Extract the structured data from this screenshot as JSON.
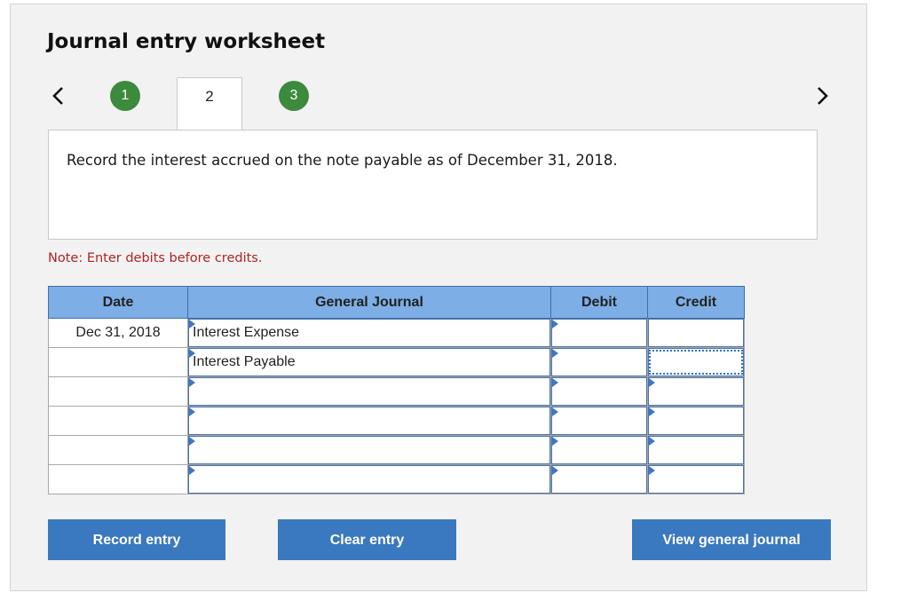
{
  "worksheet": {
    "title": "Journal entry worksheet",
    "steps": [
      "1",
      "2",
      "3"
    ],
    "active_step": "2",
    "prompt": "Record the interest accrued on the note payable as of December 31, 2018.",
    "note": "Note: Enter debits before credits."
  },
  "icons": {
    "prev": "chevron-left-icon",
    "next": "chevron-right-icon"
  },
  "colors": {
    "step_complete": "#3c8a3c",
    "header": "#7daee5",
    "button": "#3a78bf",
    "note": "#b22222"
  },
  "table": {
    "headers": [
      "Date",
      "General Journal",
      "Debit",
      "Credit"
    ],
    "rows": [
      {
        "date": "Dec 31, 2018",
        "account": "Interest Expense",
        "debit": "",
        "credit": ""
      },
      {
        "date": "",
        "account": "Interest Payable",
        "debit": "",
        "credit": ""
      },
      {
        "date": "",
        "account": "",
        "debit": "",
        "credit": ""
      },
      {
        "date": "",
        "account": "",
        "debit": "",
        "credit": ""
      },
      {
        "date": "",
        "account": "",
        "debit": "",
        "credit": ""
      },
      {
        "date": "",
        "account": "",
        "debit": "",
        "credit": ""
      }
    ]
  },
  "buttons": {
    "record": "Record entry",
    "clear": "Clear entry",
    "view": "View general journal"
  }
}
